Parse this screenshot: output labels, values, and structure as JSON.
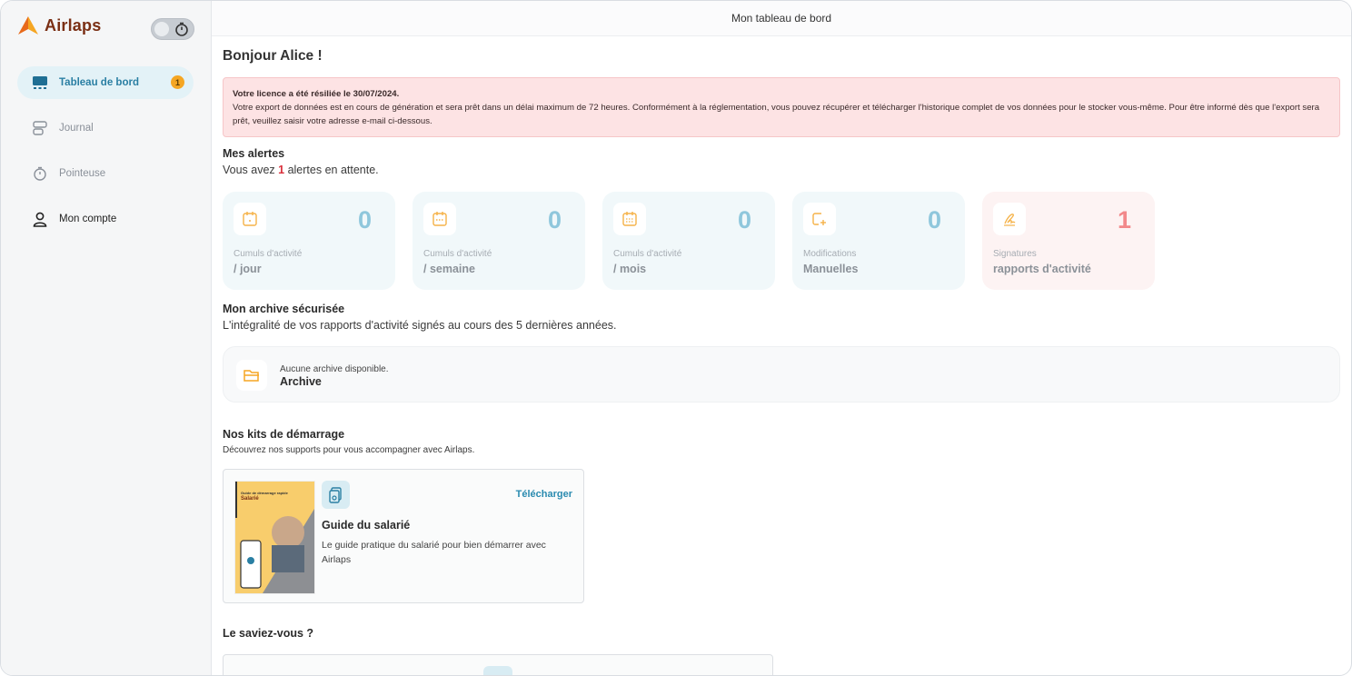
{
  "brand": {
    "name": "Airlaps"
  },
  "sidebar": {
    "items": [
      {
        "label": "Tableau de bord",
        "icon": "dashboard-icon",
        "badge": "1",
        "active": true
      },
      {
        "label": "Journal",
        "icon": "journal-icon"
      },
      {
        "label": "Pointeuse",
        "icon": "stopwatch-icon"
      },
      {
        "label": "Mon compte",
        "icon": "user-icon"
      }
    ]
  },
  "topbar": {
    "title": "Mon tableau de bord"
  },
  "greeting": "Bonjour Alice !",
  "alert": {
    "title": "Votre licence a été résiliée le 30/07/2024.",
    "body": "Votre export de données est en cours de génération et sera prêt dans un délai maximum de 72 heures. Conformément à la réglementation, vous pouvez récupérer et télécharger l'historique complet de vos données pour le stocker vous-même. Pour être informé dès que l'export sera prêt, veuillez saisir votre adresse e-mail ci-dessous."
  },
  "alerts_section": {
    "title": "Mes alertes",
    "prefix": "Vous avez ",
    "count": "1",
    "suffix": " alertes en attente."
  },
  "cards": [
    {
      "count": "0",
      "label1": "Cumuls d'activité",
      "label2": "/ jour",
      "icon": "calendar-day-icon"
    },
    {
      "count": "0",
      "label1": "Cumuls d'activité",
      "label2": "/ semaine",
      "icon": "calendar-week-icon"
    },
    {
      "count": "0",
      "label1": "Cumuls d'activité",
      "label2": "/ mois",
      "icon": "calendar-month-icon"
    },
    {
      "count": "0",
      "label1": "Modifications",
      "label2": "Manuelles",
      "icon": "edit-add-icon"
    },
    {
      "count": "1",
      "label1": "Signatures",
      "label2": "rapports d'activité",
      "icon": "signature-icon"
    }
  ],
  "archive_section": {
    "title": "Mon archive sécurisée",
    "subtitle": "L'intégralité de vos rapports d'activité signés au cours des 5 dernières années.",
    "card": {
      "status": "Aucune archive disponible.",
      "label": "Archive"
    }
  },
  "kits_section": {
    "title": "Nos kits de démarrage",
    "subtitle": "Découvrez nos supports pour vous accompagner avec Airlaps.",
    "kit": {
      "download": "Télécharger",
      "title": "Guide du salarié",
      "description": "Le guide pratique du salarié pour bien démarrer avec Airlaps",
      "thumb_title": "Guide de démarrage rapide",
      "thumb_subtitle": "Salarié"
    }
  },
  "tip_section": {
    "title": "Le saviez-vous ?"
  },
  "colors": {
    "accent": "#2a7fa3",
    "brand": "#7a2f14",
    "alert_bg": "#fde3e4",
    "badge": "#f5a623"
  }
}
